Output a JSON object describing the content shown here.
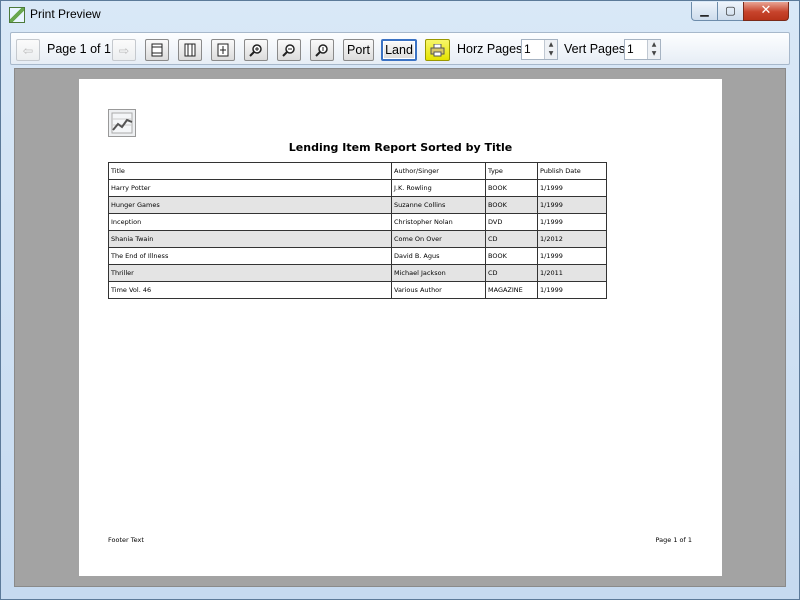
{
  "window": {
    "title": "Print Preview"
  },
  "toolbar": {
    "page_label": "Page 1 of 1",
    "portrait_label": "Port",
    "landscape_label": "Land",
    "horz_pages_label": "Horz Pages",
    "horz_pages_value": "1",
    "vert_pages_label": "Vert Pages",
    "vert_pages_value": "1"
  },
  "report": {
    "title": "Lending Item Report Sorted by Title",
    "columns": [
      "Title",
      "Author/Singer",
      "Type",
      "Publish Date"
    ],
    "rows": [
      [
        "Harry Potter",
        "J.K. Rowling",
        "BOOK",
        "1/1999"
      ],
      [
        "Hunger Games",
        "Suzanne Collins",
        "BOOK",
        "1/1999"
      ],
      [
        "Inception",
        "Christopher Nolan",
        "DVD",
        "1/1999"
      ],
      [
        "Shania Twain",
        "Come On Over",
        "CD",
        "1/2012"
      ],
      [
        "The End of Illness",
        "David B. Agus",
        "BOOK",
        "1/1999"
      ],
      [
        "Thriller",
        "Michael Jackson",
        "CD",
        "1/2011"
      ],
      [
        "Time Vol. 46",
        "Various Author",
        "MAGAZINE",
        "1/1999"
      ]
    ],
    "footer_left": "Footer Text",
    "footer_right": "Page 1 of 1"
  },
  "colors": {
    "accent": "#3a72c4",
    "print_button": "#e4e200",
    "preview_bg": "#a3a3a3"
  }
}
